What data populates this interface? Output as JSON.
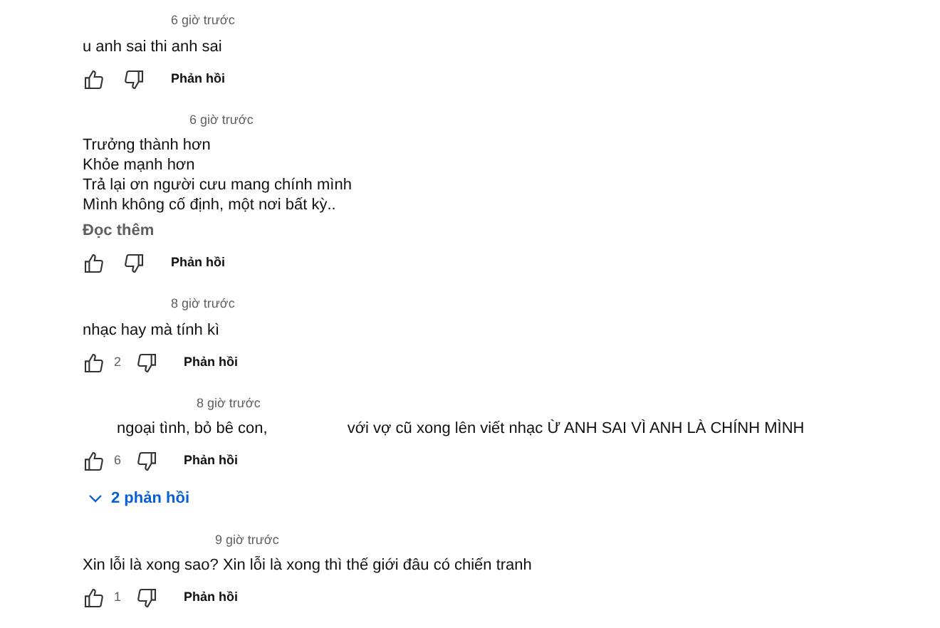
{
  "comments": [
    {
      "time": "6 giờ trước",
      "lines": [
        "u anh sai thi anh sai"
      ],
      "reply_label": "Phản hồi"
    },
    {
      "time": "6 giờ trước",
      "lines": [
        "Trưởng thành hơn",
        "Khỏe mạnh hơn",
        "Trả lại ơn người cưu mang chính mình",
        "Mình không cố định, một nơi bất kỳ.."
      ],
      "read_more": "Đọc thêm",
      "reply_label": "Phản hồi"
    },
    {
      "time": "8 giờ trước",
      "lines": [
        "nhạc hay mà tính kì"
      ],
      "likes": "2",
      "reply_label": "Phản hồi"
    },
    {
      "time": "8 giờ trước",
      "segments": [
        "ngoại tình, bỏ bê con,",
        "với vợ cũ xong lên viết nhạc Ừ ANH SAI VÌ ANH LÀ CHÍNH MÌNH"
      ],
      "likes": "6",
      "reply_label": "Phản hồi",
      "replies": "2 phản hồi",
      "replies_expanded": false
    },
    {
      "time": "9 giờ trước",
      "lines": [
        "Xin lỗi là xong sao? Xin lỗi là xong thì thế giới đâu có chiến tranh"
      ],
      "likes": "1",
      "reply_label": "Phản hồi"
    }
  ]
}
